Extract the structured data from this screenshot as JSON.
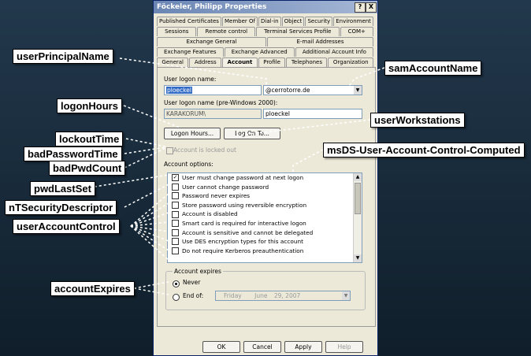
{
  "dialog": {
    "title": "Föckeler, Philipp Properties",
    "help_button": "?",
    "close_button": "X",
    "tab_rows": [
      [
        "Published Certificates",
        "Member Of",
        "Dial-in",
        "Object",
        "Security",
        "Environment"
      ],
      [
        "Sessions",
        "Remote control",
        "Terminal Services Profile",
        "COM+"
      ],
      [
        "Exchange General",
        "E-mail Addresses"
      ],
      [
        "Exchange Features",
        "Exchange Advanced",
        "Additional Account Info"
      ],
      [
        "General",
        "Address",
        "Account",
        "Profile",
        "Telephones",
        "Organization"
      ]
    ],
    "active_tab": "Account",
    "account": {
      "logon_name_label": "User logon name:",
      "logon_name_value": "ploeckel",
      "domain_value": "@cerrotorre.de",
      "pre2000_label": "User logon name (pre-Windows 2000):",
      "pre2000_domain": "KARAKORUM\\",
      "pre2000_name": "ploeckel",
      "logon_hours_button": "Logon Hours...",
      "logon_to_button": "Log On To...",
      "unlock_label": "Account is locked out",
      "options_label": "Account options:",
      "options": [
        {
          "label": "User must change password at next logon",
          "checked": true
        },
        {
          "label": "User cannot change password",
          "checked": false
        },
        {
          "label": "Password never expires",
          "checked": false
        },
        {
          "label": "Store password using reversible encryption",
          "checked": false
        },
        {
          "label": "Account is disabled",
          "checked": false
        },
        {
          "label": "Smart card is required for interactive logon",
          "checked": false
        },
        {
          "label": "Account is sensitive and cannot be delegated",
          "checked": false
        },
        {
          "label": "Use DES encryption types for this account",
          "checked": false
        },
        {
          "label": "Do not require Kerberos preauthentication",
          "checked": false
        }
      ],
      "expires_label": "Account expires",
      "never_label": "Never",
      "endof_label": "End of:",
      "end_date": {
        "day": "Friday",
        "month": "June",
        "date": "29, 2007"
      }
    },
    "buttons": {
      "ok": "OK",
      "cancel": "Cancel",
      "apply": "Apply",
      "help": "Help"
    }
  },
  "annotations": [
    "userPrincipalName",
    "samAccountName",
    "logonHours",
    "userWorkstations",
    "lockoutTime",
    "badPasswordTime",
    "badPwdCount",
    "msDS-User-Account-Control-Computed",
    "pwdLastSet",
    "nTSecurityDescriptor",
    "userAccountControl",
    "accountExpires"
  ],
  "colors": {
    "background": "#1a2c3c",
    "dialog": "#ece9d8",
    "titlebar": "#6b86b4",
    "selection": "#316ac5"
  }
}
